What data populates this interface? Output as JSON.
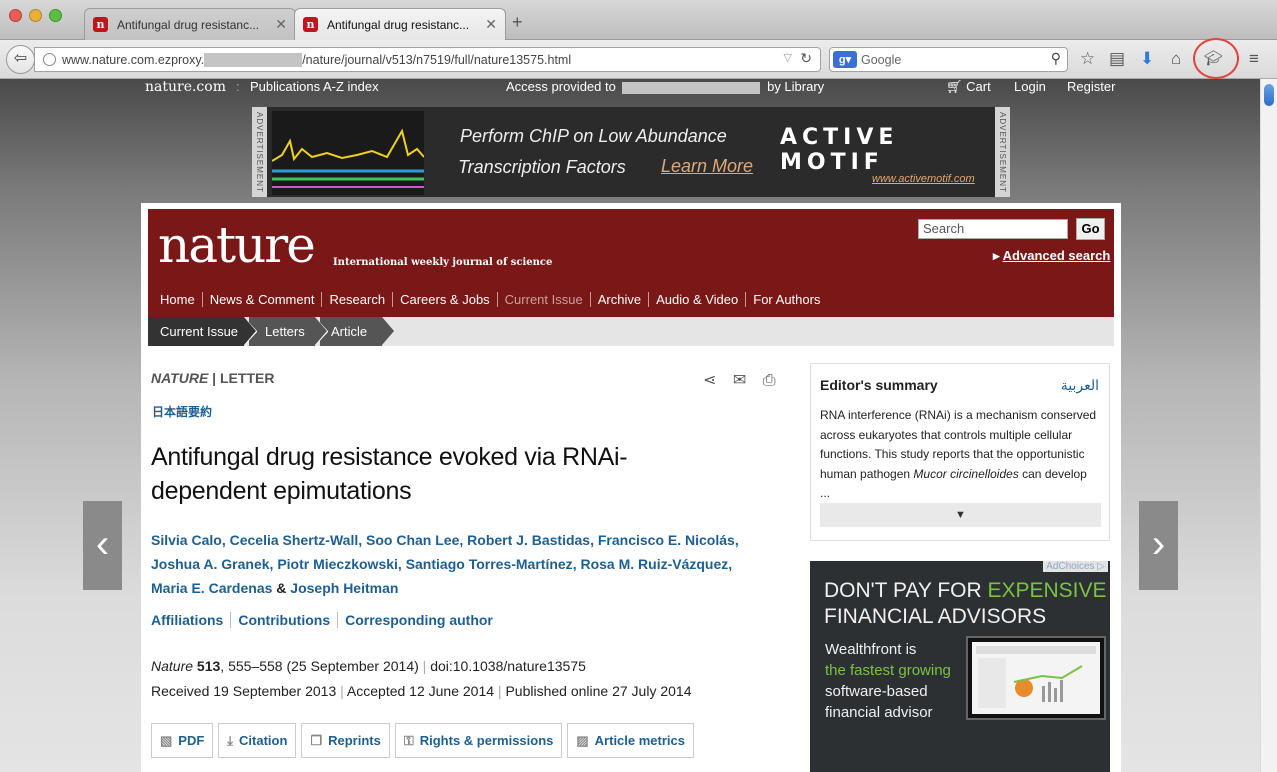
{
  "browser": {
    "tabs": [
      {
        "title": "Antifungal drug resistanc..."
      },
      {
        "title": "Antifungal drug resistanc..."
      }
    ],
    "url_host": "www.nature.com.ezproxy.",
    "url_path": "/nature/journal/v513/n7519/full/nature13575.html",
    "search_engine": "Google",
    "search_placeholder": "Google"
  },
  "topbar": {
    "logo": "nature.com",
    "publications": "Publications A-Z index",
    "access_prefix": "Access provided to",
    "access_suffix": "by Library",
    "cart": "Cart",
    "login": "Login",
    "register": "Register"
  },
  "ad_banner": {
    "label": "ADVERTISEMENT",
    "line1": "Perform ChIP on Low Abundance",
    "line2": "Transcription Factors",
    "cta": "Learn More",
    "brand": "ACTIVE MOTIF",
    "url": "www.activemotif.com"
  },
  "journal": {
    "wordmark": "nature",
    "tagline": "International weekly journal of science",
    "search_placeholder": "Search",
    "go_label": "Go",
    "advanced_search": "Advanced search",
    "nav": [
      "Home",
      "News & Comment",
      "Research",
      "Careers & Jobs",
      "Current Issue",
      "Archive",
      "Audio & Video",
      "For Authors"
    ],
    "breadcrumb": [
      "Current Issue",
      "Letters",
      "Article"
    ]
  },
  "article": {
    "journal_name": "NATURE",
    "type": "LETTER",
    "japanese": "日本語要約",
    "title": "Antifungal drug resistance evoked via RNAi-dependent epimutations",
    "authors": [
      "Silvia Calo",
      "Cecelia Shertz-Wall",
      "Soo Chan Lee",
      "Robert J. Bastidas",
      "Francisco E. Nicolás",
      "Joshua A. Granek",
      "Piotr Mieczkowski",
      "Santiago Torres-Martínez",
      "Rosa M. Ruiz-Vázquez",
      "Maria E. Cardenas",
      "Joseph Heitman"
    ],
    "links": [
      "Affiliations",
      "Contributions",
      "Corresponding author"
    ],
    "citation_journal": "Nature",
    "citation_volume": "513",
    "citation_pages": "555–558",
    "citation_date": "(25 September 2014)",
    "doi": "doi:10.1038/nature13575",
    "received_label": "Received",
    "received": "19 September 2013",
    "accepted_label": "Accepted",
    "accepted": "12 June 2014",
    "published_label": "Published online",
    "published": "27 July 2014",
    "tools": [
      "PDF",
      "Citation",
      "Reprints",
      "Rights & permissions",
      "Article metrics"
    ]
  },
  "editors_summary": {
    "heading": "Editor's summary",
    "arabic": "العربية",
    "text_1": "RNA interference (RNAi) is a mechanism conserved across eukaryotes that controls multiple cellular functions. This study reports that the opportunistic human pathogen ",
    "text_italic": "Mucor circinelloides",
    "text_2": " can develop",
    "ellipsis": "..."
  },
  "side_ad": {
    "adchoices": "AdChoices",
    "headline_1": "DON'T PAY FOR ",
    "headline_accent": "EXPENSIVE",
    "headline_2": "FINANCIAL ADVISORS",
    "body_1": "Wealthfront is",
    "body_accent": "the fastest growing",
    "body_2": "software-based",
    "body_3": "financial advisor"
  },
  "colors": {
    "nature_red": "#7a1717",
    "link_blue": "#1d5f94",
    "wealthfront_green": "#7ac242"
  }
}
